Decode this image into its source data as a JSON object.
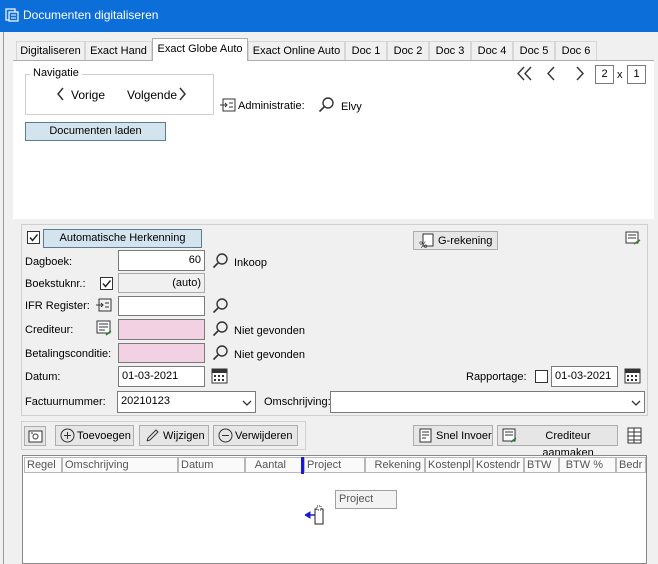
{
  "window": {
    "title": "Documenten digitaliseren"
  },
  "tabs": [
    "Digitaliseren",
    "Exact Hand",
    "Exact Globe Auto",
    "Exact Online Auto",
    "Doc 1",
    "Doc 2",
    "Doc 3",
    "Doc 4",
    "Doc 5",
    "Doc 6"
  ],
  "active_tab": "Exact Globe Auto",
  "pager": {
    "current": "2",
    "separator": "x",
    "total": "1"
  },
  "navigatie": {
    "title": "Navigatie",
    "prev_label": "Vorige",
    "next_label": "Volgende"
  },
  "administratie": {
    "label": "Administratie:",
    "value": "Elvy"
  },
  "load_button": "Documenten laden",
  "auto_recognition": {
    "label": "Automatische Herkenning",
    "checked": true
  },
  "g_rekening_button": "G-rekening",
  "form": {
    "dagboek": {
      "label": "Dagboek:",
      "value": "60",
      "suffix": "Inkoop"
    },
    "boekstuknr": {
      "label": "Boekstuknr.:",
      "value": "(auto)",
      "checked": true
    },
    "ifr": {
      "label": "IFR Register:",
      "value": ""
    },
    "crediteur": {
      "label": "Crediteur:",
      "value": "",
      "status": "Niet gevonden"
    },
    "betalingsconditie": {
      "label": "Betalingsconditie:",
      "value": "",
      "status": "Niet gevonden"
    },
    "datum": {
      "label": "Datum:",
      "value": "01-03-2021"
    },
    "rapportage": {
      "label": "Rapportage:",
      "value": "01-03-2021",
      "checked": false
    },
    "factuurnummer": {
      "label": "Factuurnummer:",
      "value": "20210123"
    },
    "omschrijving": {
      "label": "Omschrijving:",
      "value": ""
    }
  },
  "toolbar": {
    "add": "Toevoegen",
    "edit": "Wijzigen",
    "delete": "Verwijderen",
    "quick_entry": "Snel Invoer",
    "create_creditor": "Crediteur aanmaken"
  },
  "grid": {
    "columns": [
      "Regel",
      "Omschrijving",
      "Datum",
      "Aantal",
      "Project",
      "Rekening",
      "Kostenpl",
      "Kostendr",
      "BTW",
      "BTW %",
      "Bedr"
    ],
    "drag_label": "Project"
  },
  "colors": {
    "title_bar": "#0c6ed8",
    "required_field": "#f2d2e2",
    "blue_button": "#d4e4ef"
  }
}
